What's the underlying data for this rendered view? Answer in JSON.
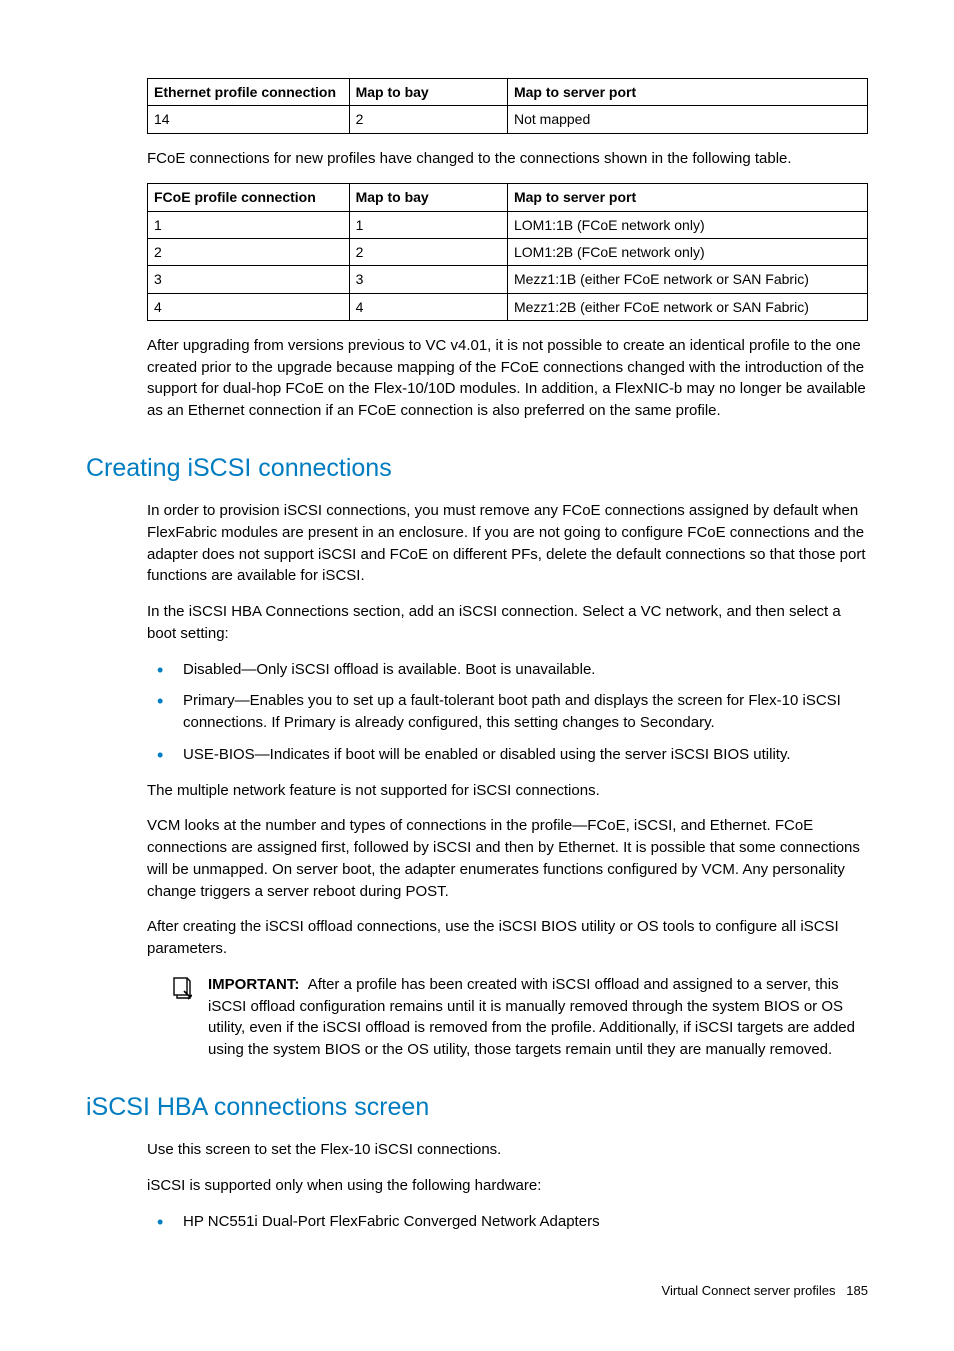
{
  "table1": {
    "headers": [
      "Ethernet profile connection",
      "Map to bay",
      "Map to server port"
    ],
    "rows": [
      [
        "14",
        "2",
        "Not mapped"
      ]
    ]
  },
  "para1": "FCoE connections for new profiles have changed to the connections shown in the following table.",
  "table2": {
    "headers": [
      "FCoE profile connection",
      "Map to bay",
      "Map to server port"
    ],
    "rows": [
      [
        "1",
        "1",
        "LOM1:1B (FCoE network only)"
      ],
      [
        "2",
        "2",
        "LOM1:2B (FCoE network only)"
      ],
      [
        "3",
        "3",
        "Mezz1:1B (either FCoE network or SAN Fabric)"
      ],
      [
        "4",
        "4",
        "Mezz1:2B (either FCoE network or SAN Fabric)"
      ]
    ]
  },
  "para2": "After upgrading from versions previous to VC v4.01, it is not possible to create an identical profile to the one created prior to the upgrade because mapping of the FCoE connections changed with the introduction of the support for dual-hop FCoE on the Flex-10/10D modules. In addition, a FlexNIC-b may no longer be available as an Ethernet connection if an FCoE connection is also preferred on the same profile.",
  "heading1": "Creating iSCSI connections",
  "para3": "In order to provision iSCSI connections, you must remove any FCoE connections assigned by default when FlexFabric modules are present in an enclosure. If you are not going to configure FCoE connections and the adapter does not support iSCSI and FCoE on different PFs, delete the default connections so that those port functions are available for iSCSI.",
  "para4": "In the iSCSI HBA Connections section, add an iSCSI connection. Select a VC network, and then select a boot setting:",
  "list1": [
    "Disabled—Only iSCSI offload is available. Boot is unavailable.",
    "Primary—Enables you to set up a fault-tolerant boot path and displays the screen for Flex-10 iSCSI connections. If Primary is already configured, this setting changes to Secondary.",
    "USE-BIOS—Indicates if boot will be enabled or disabled using the server iSCSI BIOS utility."
  ],
  "para5": "The multiple network feature is not supported for iSCSI connections.",
  "para6": "VCM looks at the number and types of connections in the profile—FCoE, iSCSI, and Ethernet. FCoE connections are assigned first, followed by iSCSI and then by Ethernet. It is possible that some connections will be unmapped. On server boot, the adapter enumerates functions configured by VCM. Any personality change triggers a server reboot during POST.",
  "para7": "After creating the iSCSI offload connections, use the iSCSI BIOS utility or OS tools to configure all iSCSI parameters.",
  "important": {
    "label": "IMPORTANT:",
    "text": "After a profile has been created with iSCSI offload and assigned to a server, this iSCSI offload configuration remains until it is manually removed through the system BIOS or OS utility, even if the iSCSI offload is removed from the profile. Additionally, if iSCSI targets are added using the system BIOS or the OS utility, those targets remain until they are manually removed."
  },
  "heading2": "iSCSI HBA connections screen",
  "para8": "Use this screen to set the Flex-10 iSCSI connections.",
  "para9": "iSCSI is supported only when using the following hardware:",
  "list2": [
    "HP NC551i Dual-Port FlexFabric Converged Network Adapters"
  ],
  "footer": {
    "section": "Virtual Connect server profiles",
    "page": "185"
  }
}
